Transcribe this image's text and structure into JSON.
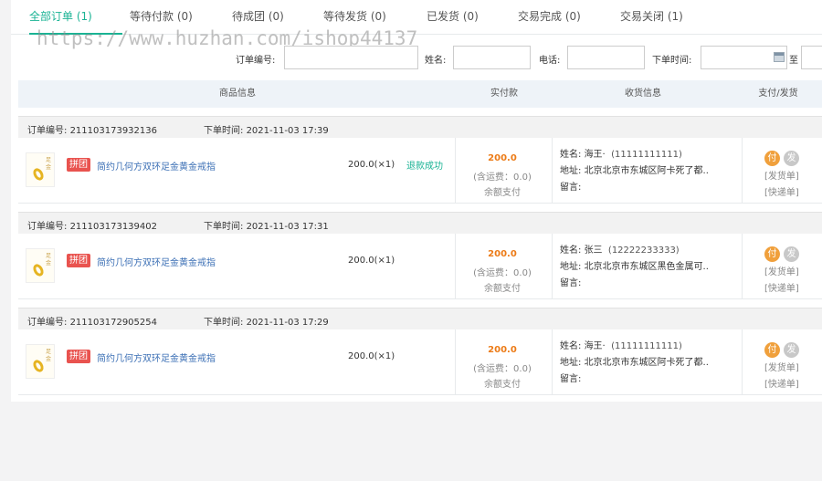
{
  "tabs": [
    {
      "label": "全部订单",
      "count": "(1)",
      "active": true
    },
    {
      "label": "等待付款",
      "count": "(0)"
    },
    {
      "label": "待成团",
      "count": "(0)"
    },
    {
      "label": "等待发货",
      "count": "(0)"
    },
    {
      "label": "已发货",
      "count": "(0)"
    },
    {
      "label": "交易完成",
      "count": "(0)"
    },
    {
      "label": "交易关闭",
      "count": "(1)"
    }
  ],
  "watermark": "https://www.huzhan.com/ishop44137",
  "filters": {
    "order_no_label": "订单编号:",
    "name_label": "姓名:",
    "phone_label": "电话:",
    "time_label": "下单时间:",
    "to_label": "至"
  },
  "table_header": {
    "product": "商品信息",
    "paid": "实付款",
    "receiver": "收货信息",
    "pay_ship": "支付/发货"
  },
  "orders": [
    {
      "order_no_label": "订单编号:",
      "order_no": "211103173932136",
      "time_label": "下单时间:",
      "time": "2021-11-03 17:39",
      "badge": "拼团",
      "product": "简约几何方双环足金黄金戒指",
      "price_qty": "200.0(×1)",
      "status": "退款成功",
      "total": "200.0",
      "shipping": "(含运费：0.0)",
      "method": "余额支付",
      "name_label": "姓名:",
      "name": "海王·",
      "phone": "(11111111111)",
      "addr_label": "地址:",
      "address": "北京北京市东城区阿卡死了都..",
      "note_label": "留言:",
      "pay_icon": "付",
      "ship_icon": "发",
      "ship_link": "[发货单]",
      "express_link": "[快递单]"
    },
    {
      "order_no_label": "订单编号:",
      "order_no": "211103173139402",
      "time_label": "下单时间:",
      "time": "2021-11-03 17:31",
      "badge": "拼团",
      "product": "简约几何方双环足金黄金戒指",
      "price_qty": "200.0(×1)",
      "status": "",
      "total": "200.0",
      "shipping": "(含运费：0.0)",
      "method": "余额支付",
      "name_label": "姓名:",
      "name": "张三",
      "phone": "(12222233333)",
      "addr_label": "地址:",
      "address": "北京北京市东城区黑色金属可..",
      "note_label": "留言:",
      "pay_icon": "付",
      "ship_icon": "发",
      "ship_link": "[发货单]",
      "express_link": "[快递单]"
    },
    {
      "order_no_label": "订单编号:",
      "order_no": "211103172905254",
      "time_label": "下单时间:",
      "time": "2021-11-03 17:29",
      "badge": "拼团",
      "product": "简约几何方双环足金黄金戒指",
      "price_qty": "200.0(×1)",
      "status": "",
      "total": "200.0",
      "shipping": "(含运费：0.0)",
      "method": "余额支付",
      "name_label": "姓名:",
      "name": "海王·",
      "phone": "(11111111111)",
      "addr_label": "地址:",
      "address": "北京北京市东城区阿卡死了都..",
      "note_label": "留言:",
      "pay_icon": "付",
      "ship_icon": "发",
      "ship_link": "[发货单]",
      "express_link": "[快递单]"
    }
  ],
  "colors": {
    "accent": "#1ab394",
    "link": "#3b6fb5",
    "price": "#ec7b17",
    "badge": "#e9534f"
  }
}
